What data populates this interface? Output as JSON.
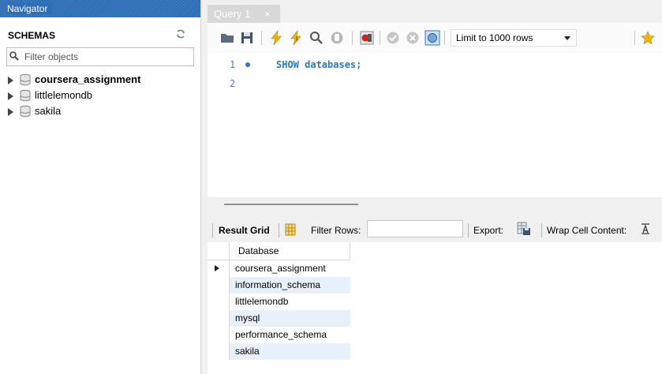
{
  "navigator": {
    "title": "Navigator",
    "schemas_label": "SCHEMAS",
    "filter_placeholder": "Filter objects",
    "schemas": [
      {
        "label": "coursera_assignment",
        "bold": true
      },
      {
        "label": "littlelemondb",
        "bold": false
      },
      {
        "label": "sakila",
        "bold": false
      }
    ]
  },
  "editor": {
    "tab_label": "Query 1",
    "tab_close": "×",
    "limit_label": "Limit to 1000 rows",
    "line_numbers": [
      "1",
      "2"
    ],
    "code": "SHOW databases;"
  },
  "results": {
    "result_grid_label": "Result Grid",
    "filter_rows_label": "Filter Rows:",
    "export_label": "Export:",
    "wrap_label": "Wrap Cell Content:",
    "column_header": "Database",
    "rows": [
      "coursera_assignment",
      "information_schema",
      "littlelemondb",
      "mysql",
      "performance_schema",
      "sakila"
    ]
  },
  "colors": {
    "navigator_header": "#2f6fb8",
    "alt_row": "#e8f0fb",
    "keyword": "#2a7ab5"
  }
}
